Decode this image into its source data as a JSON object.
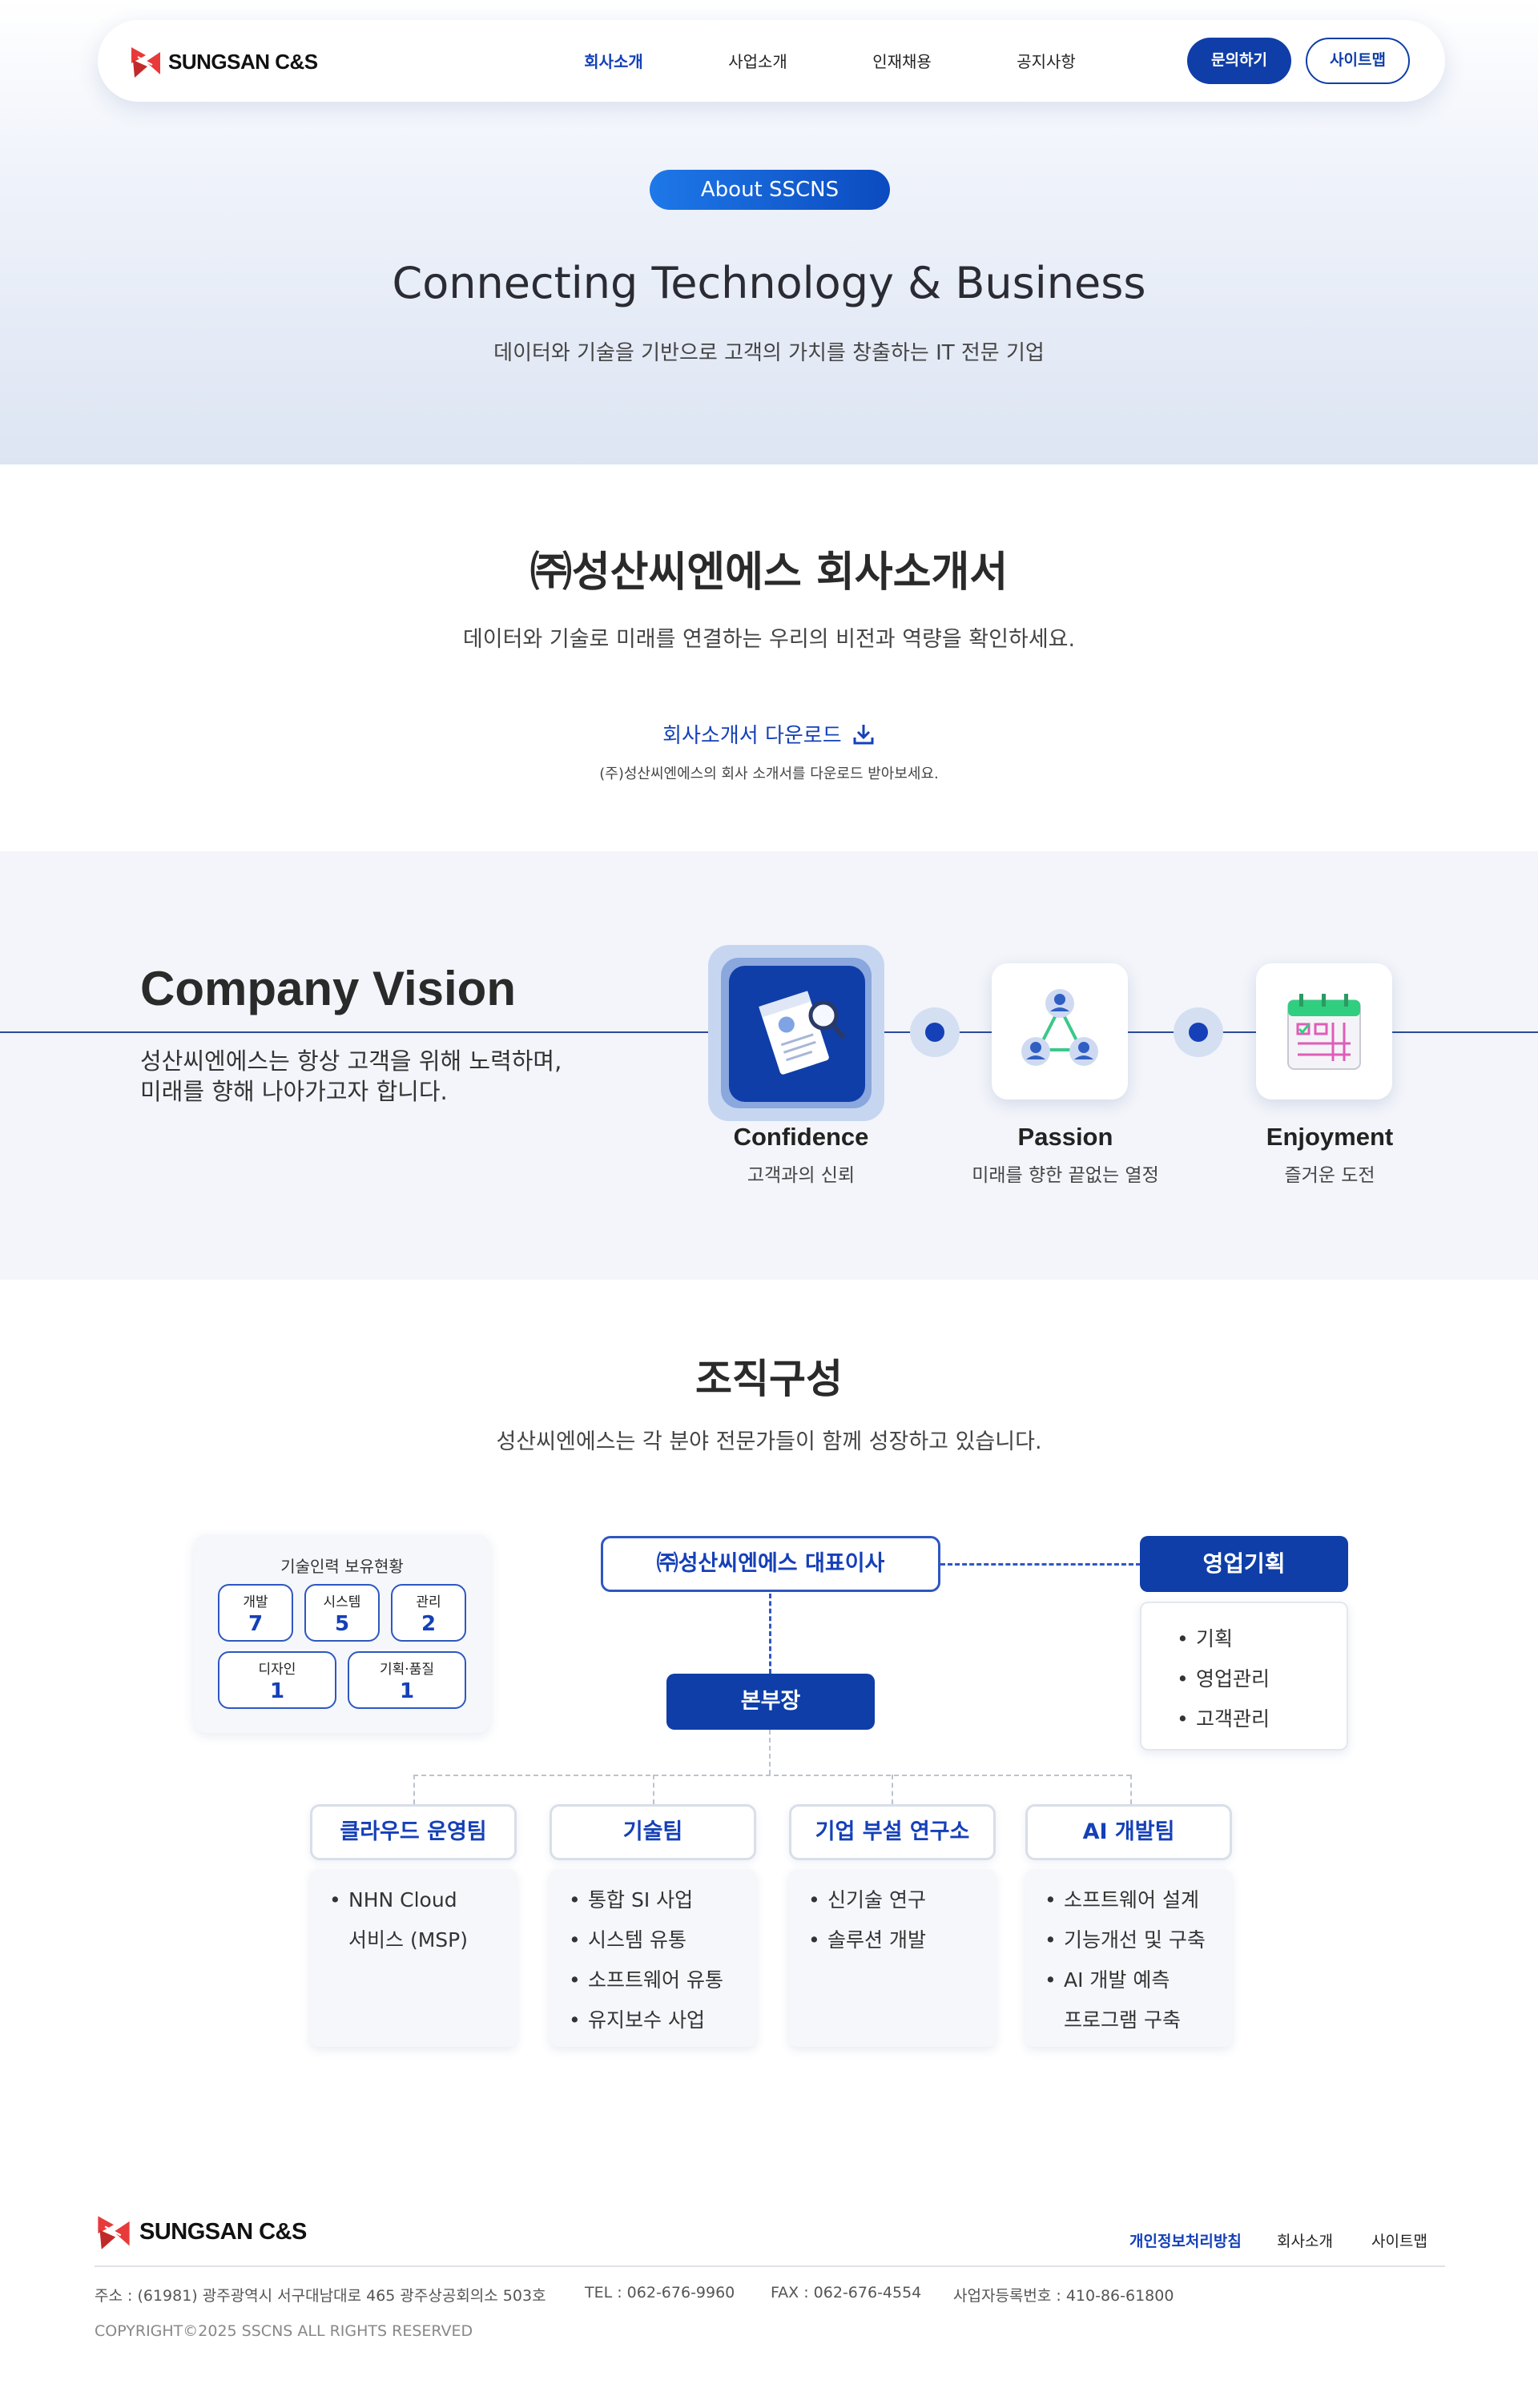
{
  "brand": {
    "name": "SUNGSAN C&S",
    "logo_color": "#e83a3a"
  },
  "nav": {
    "items": [
      {
        "label": "회사소개",
        "active": true
      },
      {
        "label": "사업소개",
        "active": false
      },
      {
        "label": "인재채용",
        "active": false
      },
      {
        "label": "공지사항",
        "active": false
      }
    ],
    "inquiry_label": "문의하기",
    "sitemap_label": "사이트맵"
  },
  "hero": {
    "badge": "About SSCNS",
    "title": "Connecting Technology & Business",
    "subtitle": "데이터와 기술을 기반으로 고객의 가치를 창출하는 IT 전문 기업"
  },
  "intro": {
    "title": "㈜성산씨엔에스 회사소개서",
    "subtitle": "데이터와 기술로 미래를 연결하는 우리의 비전과 역량을 확인하세요.",
    "download_label": "회사소개서 다운로드",
    "download_note": "(주)성산씨엔에스의 회사 소개서를 다운로드 받아보세요."
  },
  "vision": {
    "title": "Company Vision",
    "desc_line1": "성산씨엔에스는 항상 고객을 위해 노력하며,",
    "desc_line2": "미래를 향해 나아가고자 합니다.",
    "items": [
      {
        "label": "Confidence",
        "sub": "고객과의 신뢰",
        "icon": "certificate-icon"
      },
      {
        "label": "Passion",
        "sub": "미래를 향한 끝없는 열정",
        "icon": "network-people-icon"
      },
      {
        "label": "Enjoyment",
        "sub": "즐거운 도전",
        "icon": "calendar-icon"
      }
    ]
  },
  "org": {
    "title": "조직구성",
    "subtitle": "성산씨엔에스는 각 분야 전문가들이 함께 성장하고 있습니다.",
    "skills": {
      "title": "기술인력 보유현황",
      "items": [
        {
          "label": "개발",
          "count": "7"
        },
        {
          "label": "시스템",
          "count": "5"
        },
        {
          "label": "관리",
          "count": "2"
        },
        {
          "label": "디자인",
          "count": "1"
        },
        {
          "label": "기획·품질",
          "count": "1"
        }
      ]
    },
    "ceo": "㈜성산씨엔에스 대표이사",
    "sales": {
      "title": "영업기획",
      "items": [
        "기획",
        "영업관리",
        "고객관리"
      ]
    },
    "hq": "본부장",
    "teams": [
      {
        "title": "클라우드 운영팀",
        "items": [
          "NHN Cloud",
          "서비스 (MSP)"
        ]
      },
      {
        "title": "기술팀",
        "items": [
          "통합 SI 사업",
          "시스템 유통",
          "소프트웨어 유통",
          "유지보수 사업"
        ]
      },
      {
        "title": "기업 부설 연구소",
        "items": [
          "신기술 연구",
          "솔루션 개발"
        ]
      },
      {
        "title": "AI 개발팀",
        "items": [
          "소프트웨어 설계",
          "기능개선 및 구축",
          "AI 개발 예측",
          "프로그램 구축"
        ]
      }
    ]
  },
  "footer": {
    "links": [
      "개인정보처리방침",
      "회사소개",
      "사이트맵"
    ],
    "address": "주소 : (61981) 광주광역시 서구대남대로 465 광주상공회의소 503호",
    "tel": "TEL : 062-676-9960",
    "fax": "FAX : 062-676-4554",
    "bizno": "사업자등록번호 : 410-86-61800",
    "copyright": "COPYRIGHT©2025 SSCNS ALL RIGHTS RESERVED"
  },
  "colors": {
    "primary": "#0f3ea8",
    "accent": "#1540b8",
    "logo_red": "#e83a3a"
  }
}
